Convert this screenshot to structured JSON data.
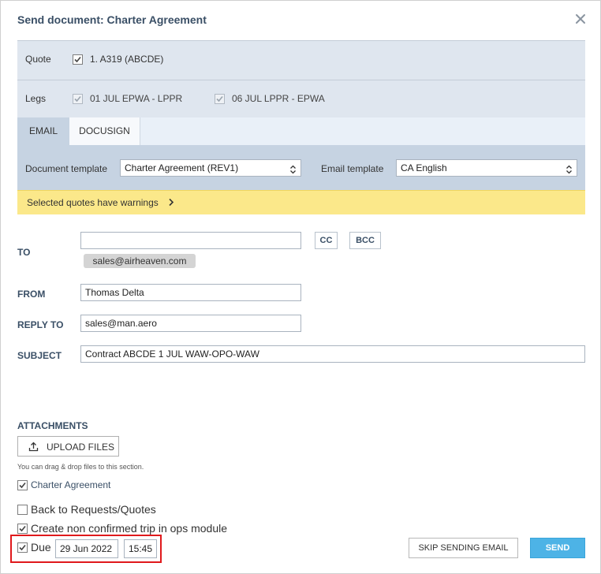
{
  "dialog": {
    "title": "Send document: Charter Agreement"
  },
  "quote": {
    "label": "Quote",
    "item": "1. A319 (ABCDE)"
  },
  "legs": {
    "label": "Legs",
    "items": [
      "01 JUL EPWA - LPPR",
      "06 JUL LPPR - EPWA"
    ]
  },
  "tabs": [
    "EMAIL",
    "DOCUSIGN"
  ],
  "templates": {
    "document_label": "Document template",
    "document_value": "Charter Agreement (REV1)",
    "email_label": "Email template",
    "email_value": "CA English"
  },
  "warning": {
    "text": "Selected quotes have warnings"
  },
  "form": {
    "to_label": "TO",
    "to_value": "",
    "cc_label": "CC",
    "bcc_label": "BCC",
    "to_chip": "sales@airheaven.com",
    "from_label": "FROM",
    "from_value": "Thomas Delta",
    "reply_label": "REPLY TO",
    "reply_value": "sales@man.aero",
    "subject_label": "SUBJECT",
    "subject_value": "Contract ABCDE 1 JUL WAW-OPO-WAW"
  },
  "attachments": {
    "title": "ATTACHMENTS",
    "upload_label": "UPLOAD FILES",
    "hint": "You can drag & drop files to this section.",
    "file": "Charter Agreement"
  },
  "options": {
    "back_label": "Back to Requests/Quotes",
    "create_label": "Create non confirmed trip in ops module",
    "due_label": "Due",
    "due_date": "29 Jun 2022",
    "due_time": "15:45"
  },
  "actions": {
    "skip_label": "SKIP SENDING EMAIL",
    "send_label": "SEND"
  },
  "colors": {
    "accent": "#4db3e6",
    "warning_bg": "#fbe88a",
    "highlight_border": "#e0191c"
  }
}
